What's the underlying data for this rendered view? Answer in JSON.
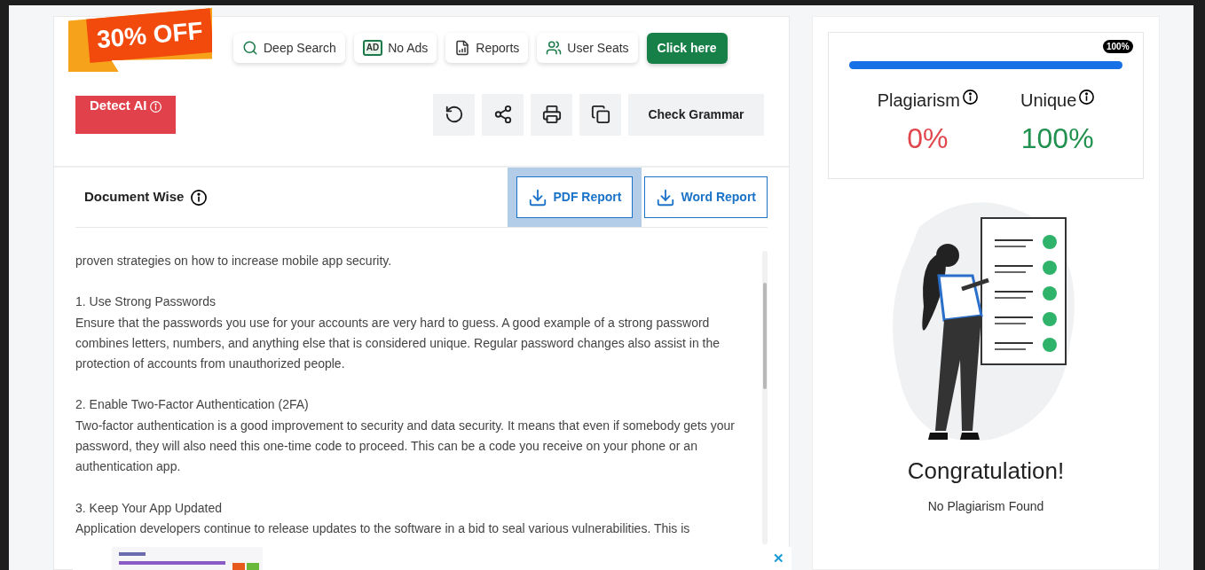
{
  "promo": {
    "label": "30% OFF"
  },
  "features": [
    {
      "kind": "search",
      "label": "Deep Search"
    },
    {
      "kind": "ads",
      "label": "No Ads",
      "badge": "AD"
    },
    {
      "kind": "reports",
      "label": "Reports"
    },
    {
      "kind": "users",
      "label": "User Seats"
    }
  ],
  "cta": {
    "label": "Click here"
  },
  "detect_ai": {
    "label": "Detect AI"
  },
  "tools": [
    {
      "kind": "reload"
    },
    {
      "kind": "share"
    },
    {
      "kind": "print"
    },
    {
      "kind": "copy"
    }
  ],
  "check_grammar": {
    "label": "Check Grammar"
  },
  "document": {
    "title": "Document Wise",
    "reports": [
      {
        "label": "PDF Report",
        "selected": true
      },
      {
        "label": "Word Report",
        "selected": false
      }
    ],
    "paragraphs": [
      "proven strategies on how to increase mobile app security.",
      "1. Use Strong Passwords\nEnsure that the passwords you use for your accounts are very hard to guess. A good example of a strong password combines letters, numbers, and anything else that is considered unique. Regular password changes also assist in the protection of accounts from unauthorized people.",
      "2. Enable Two-Factor Authentication (2FA)\nTwo-factor authentication is a good improvement to security and data security. It means that even if somebody gets your password, they will also need this one-time code to proceed. This can be a code you receive on your phone or an authentication app.",
      "3. Keep Your App Updated\nApplication developers continue to release updates to the software in a bid to seal various vulnerabilities. This is"
    ]
  },
  "result": {
    "level": 1,
    "tooltip": "100%",
    "stats": [
      {
        "label": "Plagiarism",
        "value": "0%",
        "color": "#e0474c"
      },
      {
        "label": "Unique",
        "value": "100%",
        "color": "#21914f"
      }
    ],
    "headline": "Congratulation!",
    "message": "No Plagiarism Found"
  },
  "ad": {
    "close": "✕"
  }
}
